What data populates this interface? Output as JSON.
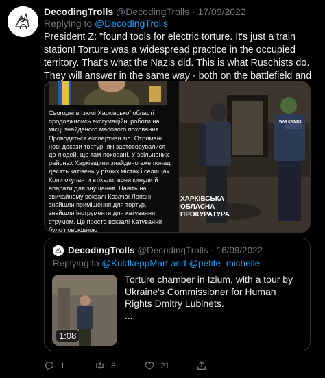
{
  "tweet": {
    "display_name": "DecodingTrolls",
    "handle": "@DecodingTrolls",
    "separator": "·",
    "date": "17/09/2022",
    "replying_to_prefix": "Replying to ",
    "replying_to": "@DecodingTrolls",
    "text": "President Z: \"found tools for electric torture. It's just a train station! Torture was a widespread practice in the occupied territory. That's what the Nazis did. This is what Ruschists do. They will answer in the same way - both on the battlefield and in courtrooms.\"",
    "media": {
      "ukrainian_text": "Сьогодні в Ізюмі Харківської області продовжились ексгумаційні роботи на місці знайденого масового поховання. Проводяться експертизи тіл. Отримані нові докази тортур, які застосовувалися до людей, що там поховані. У звільнених районах Харківщини знайдено вже понад десять катівень у різних містах і селищах. Коли окупанти втікали, вони кинули й апарати для знущання. Навіть на звичайному вокзалі Козачої Лопані знайшли приміщення для тортур, знайшли інструменти для катування струмом. Це просто вокзал! Катування було повсюдною",
      "overlay_text": "ХАРКІВСЬКА\nОБЛАСНА\nПРОКУРАТУРА",
      "vest_label": "WAR CRIMES"
    }
  },
  "quote": {
    "display_name": "DecodingTrolls",
    "handle": "@DecodingTrolls",
    "separator": "·",
    "date": "16/09/2022",
    "replying_to_prefix": "Replying to ",
    "replying_to_1": "@KuldkeppMart",
    "replying_and": " and ",
    "replying_to_2": "@petite_michelle",
    "text": "Torture chamber in Izium, with a tour by Ukraine's Commissioner for Human Rights Dmitry Lubinets.\n...",
    "video_duration": "1:08"
  },
  "actions": {
    "replies": "1",
    "retweets": "8",
    "likes": "21"
  },
  "icons": [
    "reply-icon",
    "retweet-icon",
    "like-icon",
    "share-icon"
  ],
  "colors": {
    "background": "#000000",
    "text": "#e7e9ea",
    "muted": "#71767b",
    "link": "#1d9bf0",
    "border": "#2f3336"
  }
}
